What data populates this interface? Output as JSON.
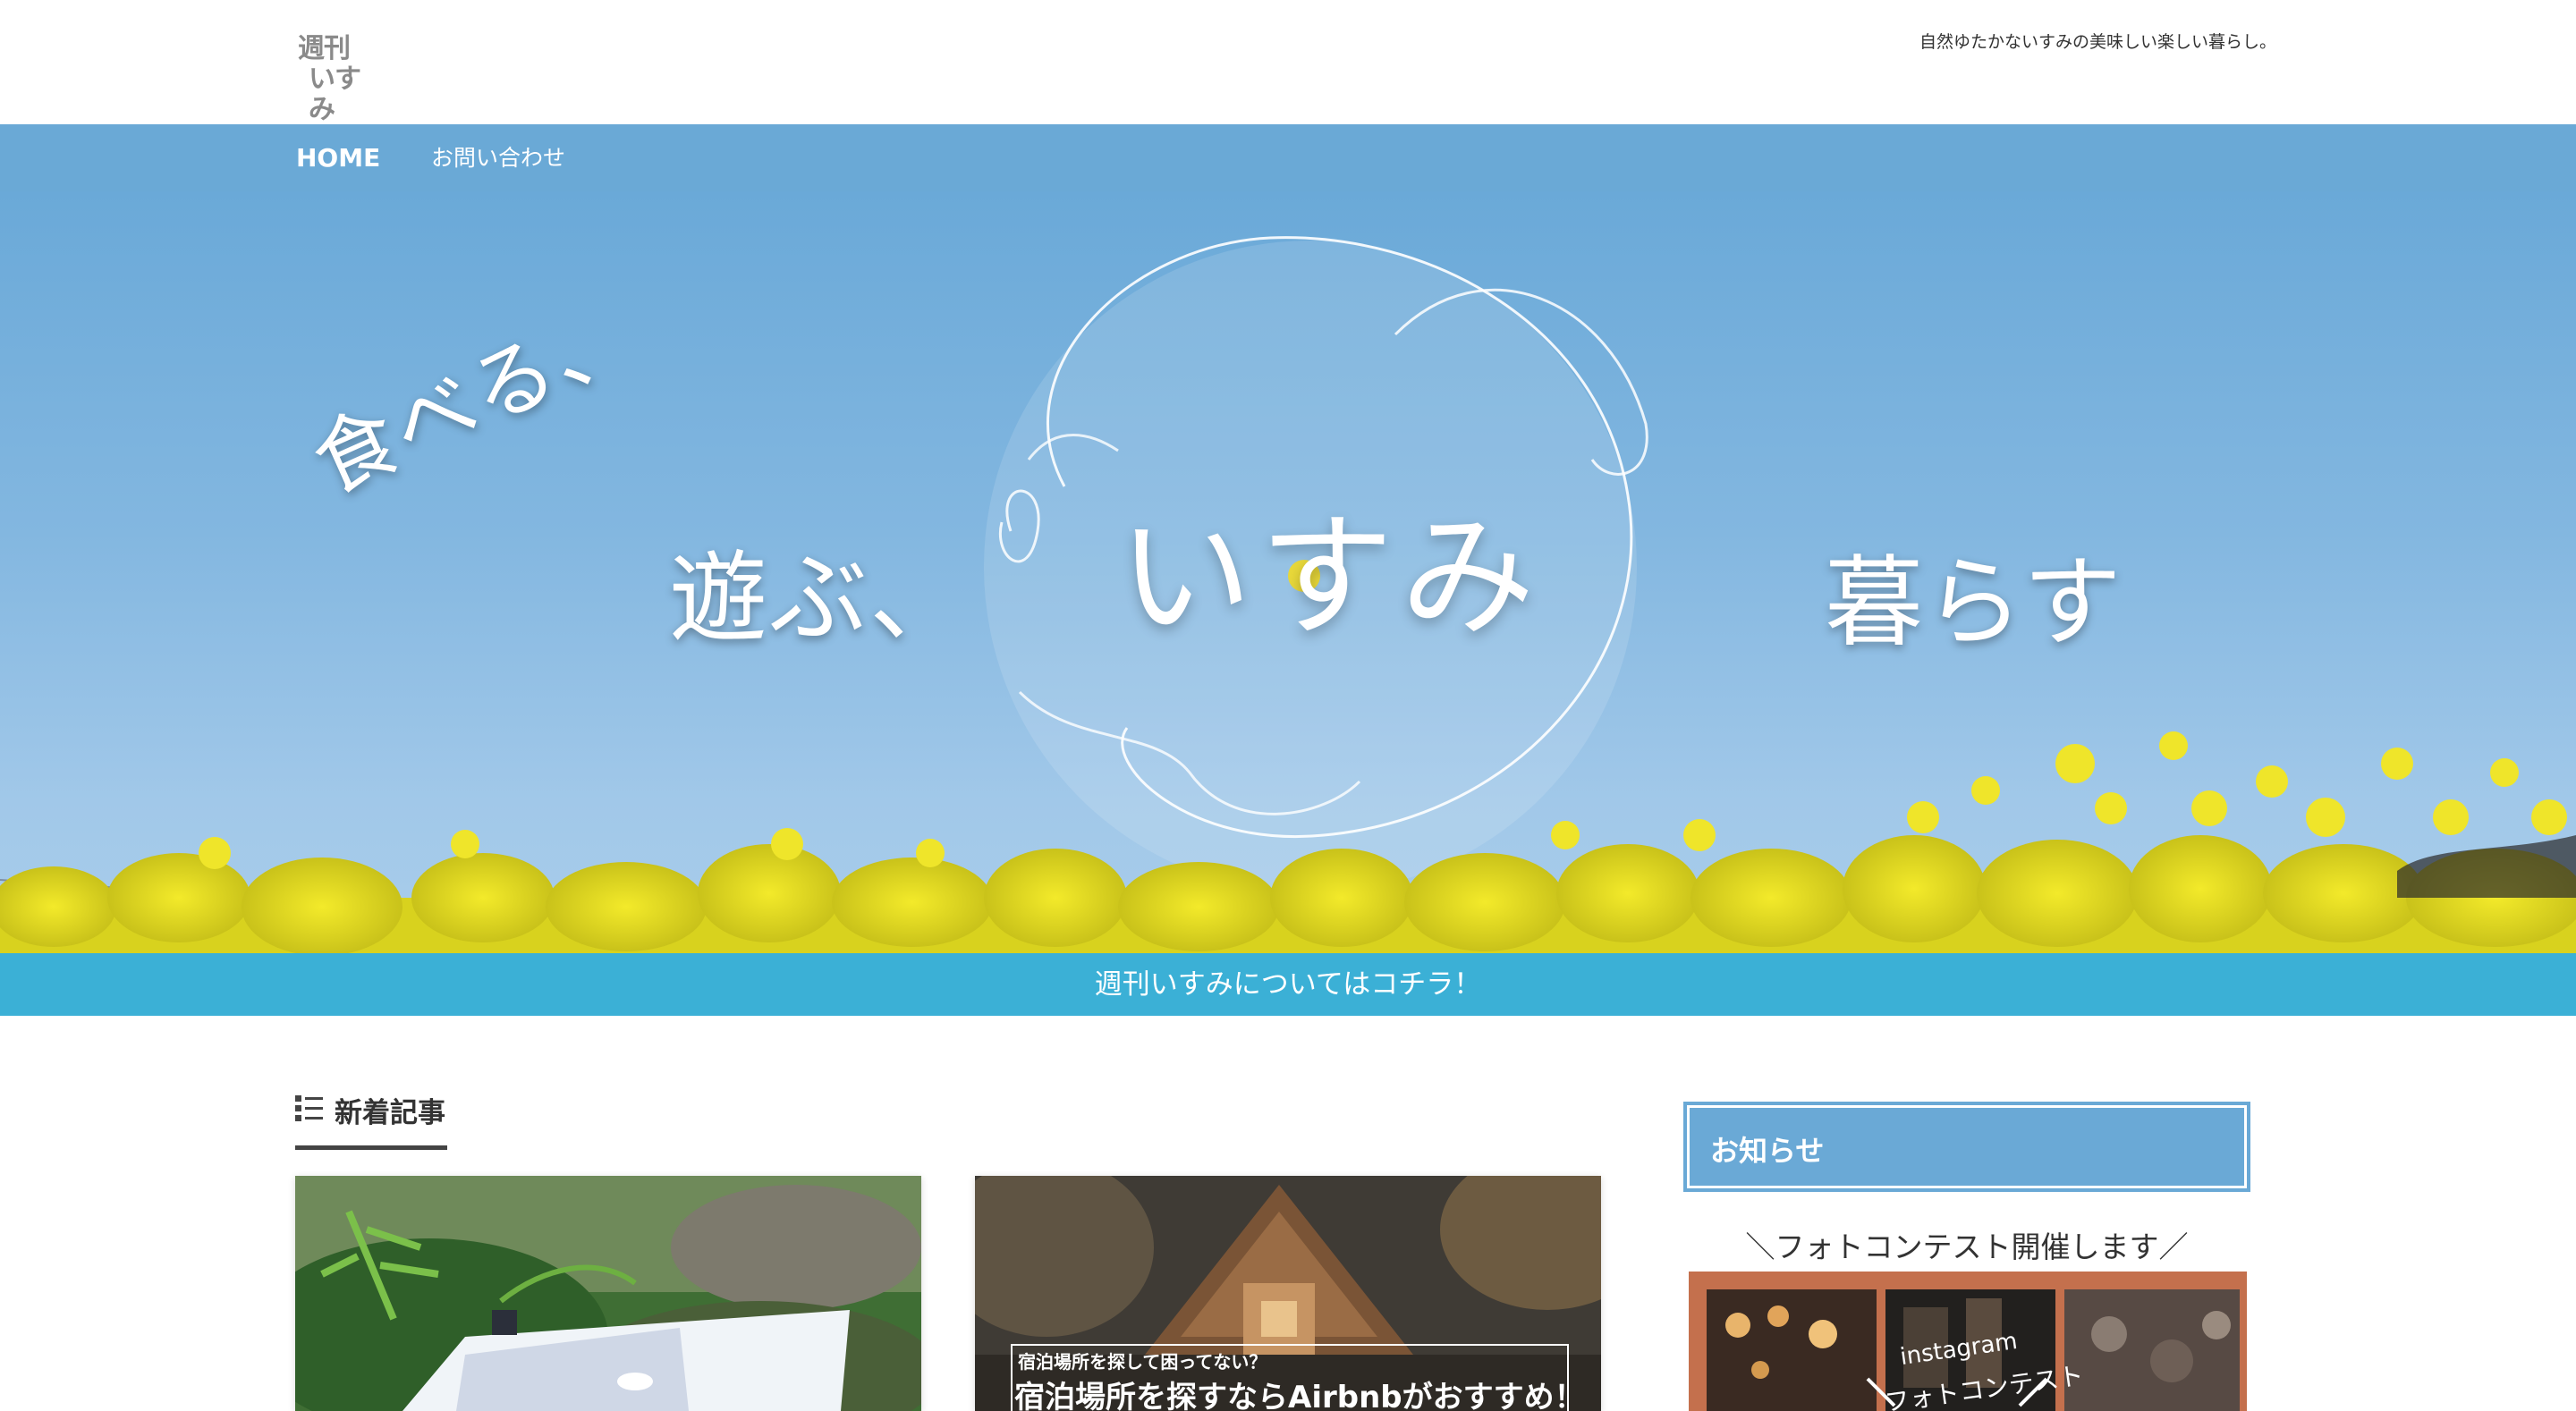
{
  "header": {
    "logo_line1": "週刊",
    "logo_line2": "いすみ",
    "tagline": "自然ゆたかないすみの美味しい楽しい暮らし。"
  },
  "nav": {
    "items": [
      {
        "label": "HOME"
      },
      {
        "label": "お問い合わせ"
      }
    ]
  },
  "hero": {
    "word1": "食べる、",
    "word2": "遊ぶ、",
    "word3": "いすみ",
    "word4": "暮らす"
  },
  "cta": {
    "label": "週刊いすみについてはコチラ！"
  },
  "main": {
    "section_title": "新着記事",
    "cards": [
      {
        "sub": "",
        "main": ""
      },
      {
        "sub": "宿泊場所を探して困ってない？",
        "main": "宿泊場所を探すならAirbnbがおすすめ！"
      }
    ]
  },
  "sidebar": {
    "notice_title": "お知らせ",
    "contest_heading": "＼フォトコンテスト開催します／",
    "banner_line1": "instagram",
    "banner_line2": "フォトコンテスト"
  },
  "colors": {
    "nav": "#6aa9d6",
    "cta": "#3bb0d6",
    "banner": "#c4704d"
  }
}
